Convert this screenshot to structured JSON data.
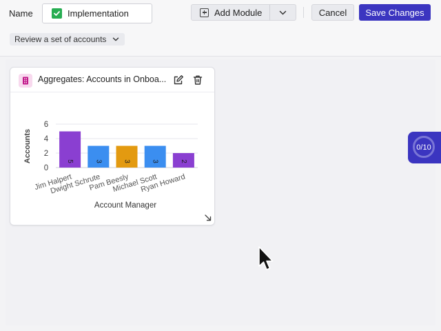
{
  "header": {
    "name_label": "Name",
    "name_value": "Implementation",
    "add_module_label": "Add Module",
    "cancel_label": "Cancel",
    "save_label": "Save Changes",
    "dataset_label": "Review a set of accounts"
  },
  "card": {
    "title": "Aggregates: Accounts in Onboa...",
    "icon": "aggregate-icon"
  },
  "progress": {
    "text": "0/10",
    "value": 0,
    "total": 10
  },
  "colors": {
    "accent": "#3b35c0",
    "check": "#27ad52",
    "purple": "#8a3fd1",
    "blue": "#3b8ef0",
    "orange": "#e39a10"
  },
  "chart_data": {
    "type": "bar",
    "categories": [
      "Jim Halpert",
      "Dwight Schrute",
      "Pam Beesly",
      "Michael Scott",
      "Ryan Howard"
    ],
    "values": [
      5,
      3,
      3,
      3,
      2
    ],
    "bar_colors": [
      "#8a3fd1",
      "#3b8ef0",
      "#e39a10",
      "#3b8ef0",
      "#8a3fd1"
    ],
    "data_labels": [
      "5",
      "3",
      "3",
      "3",
      "2"
    ],
    "xlabel": "Account Manager",
    "ylabel": "Accounts",
    "ylim": [
      0,
      6
    ],
    "yticks": [
      "0",
      "2",
      "4",
      "6"
    ],
    "grid": true
  }
}
